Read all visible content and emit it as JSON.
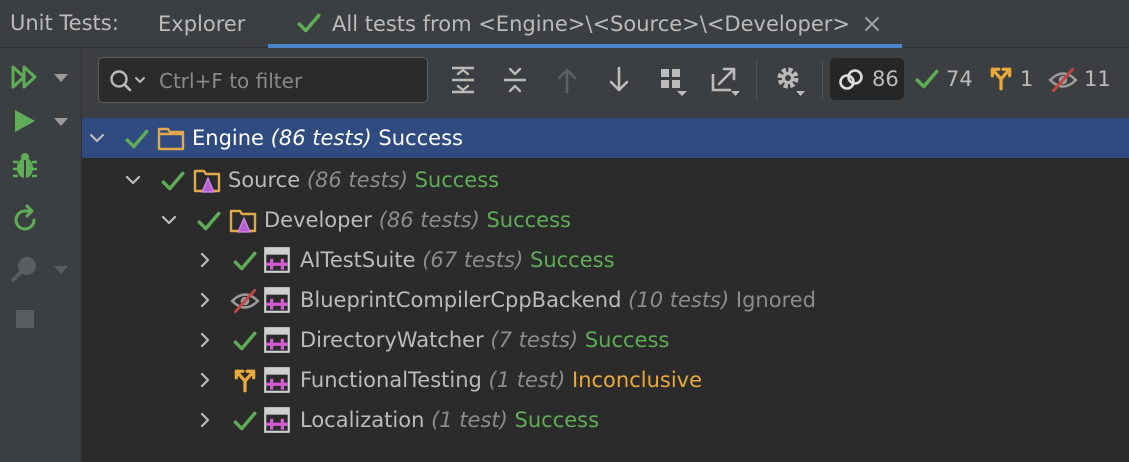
{
  "tabbar": {
    "title": "Unit Tests:",
    "tabs": [
      {
        "label": "Explorer"
      },
      {
        "label": "All tests from <Engine>\\<Source>\\<Developer>"
      }
    ]
  },
  "toolbar": {
    "search_placeholder": "Ctrl+F to filter",
    "counters": {
      "total": "86",
      "passed": "74",
      "inconclusive": "1",
      "ignored": "11"
    }
  },
  "tree": {
    "rows": [
      {
        "name": "Engine",
        "count": "(86 tests)",
        "status": "Success"
      },
      {
        "name": "Source",
        "count": "(86 tests)",
        "status": "Success"
      },
      {
        "name": "Developer",
        "count": "(86 tests)",
        "status": "Success"
      },
      {
        "name": "AITestSuite",
        "count": "(67 tests)",
        "status": "Success"
      },
      {
        "name": "BlueprintCompilerCppBackend",
        "count": "(10 tests)",
        "status": "Ignored"
      },
      {
        "name": "DirectoryWatcher",
        "count": "(7 tests)",
        "status": "Success"
      },
      {
        "name": "FunctionalTesting",
        "count": "(1 test)",
        "status": "Inconclusive"
      },
      {
        "name": "Localization",
        "count": "(1 test)",
        "status": "Success"
      }
    ]
  },
  "colors": {
    "success": "#5fad56",
    "inconclusive": "#e9a93b",
    "selection": "#2f4b80",
    "accent": "#4a88c7"
  }
}
